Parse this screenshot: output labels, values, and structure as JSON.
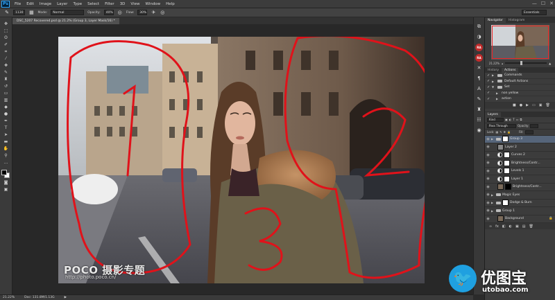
{
  "app": {
    "logo": "Ps"
  },
  "menu": [
    "File",
    "Edit",
    "Image",
    "Layer",
    "Type",
    "Select",
    "Filter",
    "3D",
    "View",
    "Window",
    "Help"
  ],
  "window_controls": [
    "—",
    "☐",
    "✕"
  ],
  "options_bar": {
    "brush_size": "1130",
    "mode_label": "Mode:",
    "mode_value": "Normal",
    "opacity_label": "Opacity:",
    "opacity_value": "40%",
    "flow_label": "Flow:",
    "flow_value": "30%",
    "workspace": "Essentials"
  },
  "document": {
    "tab_title": "DSC_5207 Recovered.psd @ 21.2% (Group 3, Layer Mask/16) *",
    "watermark_brand": "POCO 摄影专题",
    "watermark_url": "http://photo.poco.cn/",
    "annotations": [
      "1",
      "2",
      "3"
    ]
  },
  "status_bar": {
    "zoom": "21.22%",
    "doc_size": "Doc: 131.8M/1.13G",
    "arrow": "▶"
  },
  "navigator": {
    "tabs": [
      "Navigator",
      "Histogram"
    ],
    "zoom": "21.22%"
  },
  "actions_panel": {
    "tabs": [
      "History",
      "Actions"
    ],
    "rows": [
      {
        "label": "Commands",
        "indent": 0,
        "kind": "set"
      },
      {
        "label": "Default Actions",
        "indent": 0,
        "kind": "set"
      },
      {
        "label": "Set",
        "indent": 0,
        "kind": "set"
      },
      {
        "label": "non yellow",
        "indent": 1,
        "kind": "action"
      },
      {
        "label": "action",
        "indent": 1,
        "kind": "action"
      }
    ]
  },
  "layers_panel": {
    "tabs": [
      "Layers"
    ],
    "filter_kind": "Kind",
    "blend_mode": "Pass Through",
    "opacity_label": "Opacity:",
    "lock_label": "Lock:",
    "fill_label": "Fill:",
    "layers": [
      {
        "name": "Group 3",
        "type": "group-mask",
        "selected": true,
        "indent": 0
      },
      {
        "name": "Layer 2",
        "type": "layer",
        "selected": false,
        "indent": 1
      },
      {
        "name": "Curves 2",
        "type": "adj",
        "selected": false,
        "indent": 1
      },
      {
        "name": "Brightness/Contr...",
        "type": "adj",
        "selected": false,
        "indent": 1
      },
      {
        "name": "Levels 1",
        "type": "adj",
        "selected": false,
        "indent": 1
      },
      {
        "name": "Layer 1",
        "type": "adj",
        "selected": false,
        "indent": 1
      },
      {
        "name": "Brightness/Contr...",
        "type": "photo-dark",
        "selected": false,
        "indent": 1
      },
      {
        "name": "Magic Eyes",
        "type": "group",
        "selected": false,
        "indent": 0
      },
      {
        "name": "Dodge & Burn",
        "type": "group-mask",
        "selected": false,
        "indent": 0
      },
      {
        "name": "Group 1",
        "type": "group",
        "selected": false,
        "indent": 0
      },
      {
        "name": "Background",
        "type": "photo",
        "selected": false,
        "indent": 0
      }
    ],
    "footer_icons": [
      "∞",
      "fx",
      "◧",
      "◐",
      "▣",
      "▤",
      "🗑"
    ]
  },
  "site_watermark": {
    "name": "优图宝",
    "url": "utobao.com"
  }
}
